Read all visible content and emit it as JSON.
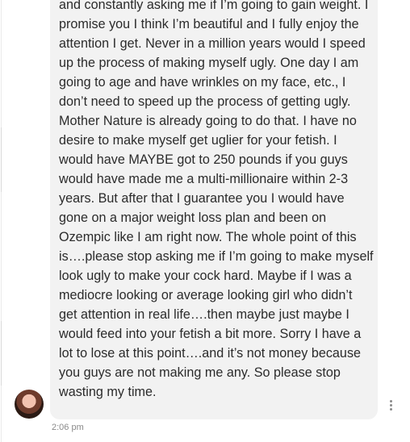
{
  "message": {
    "text": "and constantly asking me if I’m going to gain weight. I\npromise you I think I’m beautiful and I fully enjoy the\nattention I get. Never in a million years would I speed\nup the process of making myself ugly. One day I am\ngoing to age and have wrinkles on my face, etc., I\ndon’t need to speed up the process of getting ugly.\nMother Nature is already going to do that. I have no\ndesire to make myself get uglier for your fetish. I\nwould have MAYBE got to 250 pounds if you guys\nwould have made me a multi-millionaire within 2-3\nyears. But after that I guarantee you I would have\ngone on a major weight loss plan and been on\nOzempic like I am right now. The whole point of this\nis….please stop asking me if I’m going to make myself\nlook ugly to make your cock hard. Maybe if I was a\nmediocre looking or average looking girl who didn’t\nget attention in real life….then maybe just maybe I\nwould feed into your fetish a bit more. Sorry I have a\nlot to lose at this point….and it’s not money because\nyou guys are not making me any. So please stop\nwasting my time.",
    "timestamp": "2:06 pm"
  },
  "icons": {
    "avatar": "sender-avatar",
    "more": "vertical-ellipsis-icon"
  },
  "colors": {
    "bubble": "#f2f2f2",
    "text": "#2b2b2b",
    "timestamp": "#8a8a8a"
  }
}
